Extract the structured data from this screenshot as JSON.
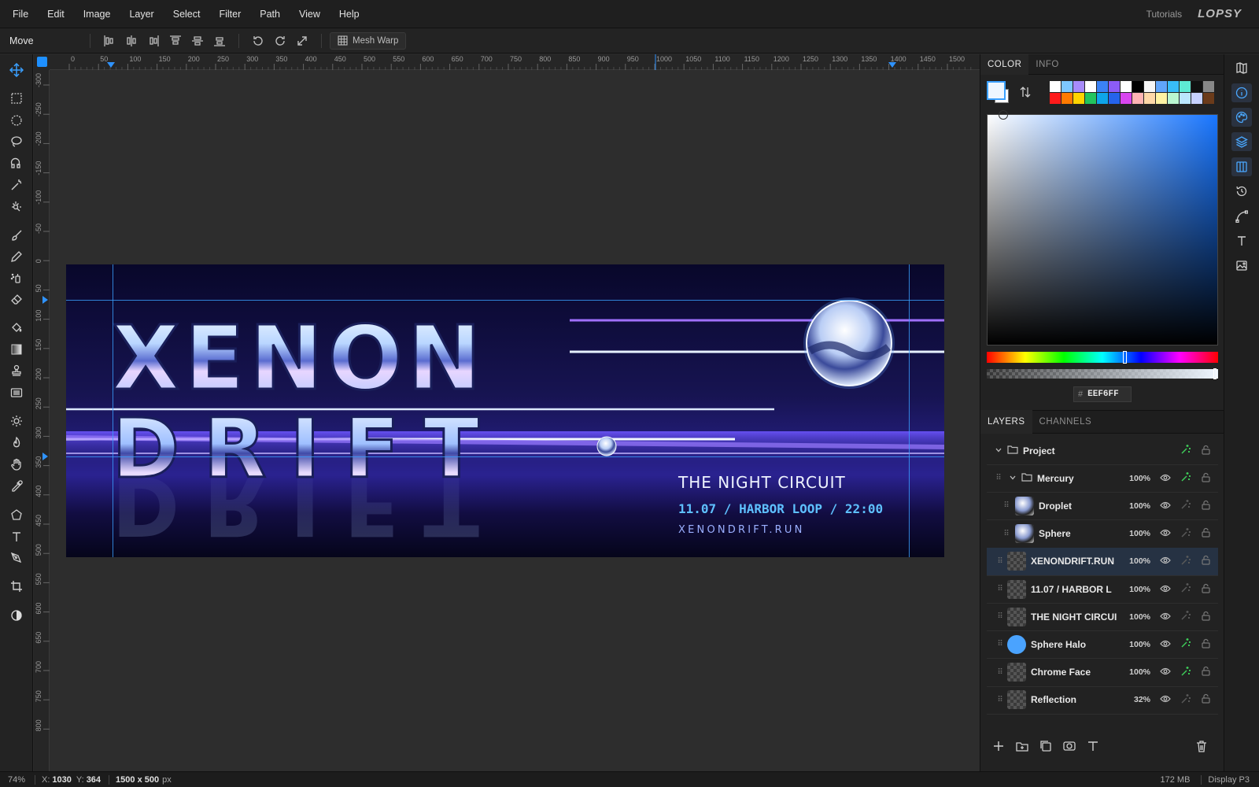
{
  "menu": {
    "items": [
      "File",
      "Edit",
      "Image",
      "Layer",
      "Select",
      "Filter",
      "Path",
      "View",
      "Help"
    ],
    "tutorials": "Tutorials",
    "logo": "LOPSY"
  },
  "options": {
    "tool_name": "Move",
    "mesh_warp": "Mesh Warp"
  },
  "ruler": {
    "top_ticks": [
      "0",
      "50",
      "100",
      "150",
      "200",
      "250",
      "300",
      "350",
      "400",
      "450",
      "500",
      "550",
      "600",
      "650",
      "700",
      "750",
      "800",
      "850",
      "900",
      "950",
      "1000",
      "1050",
      "1100",
      "1150",
      "1200",
      "1250",
      "1300",
      "1350",
      "1400",
      "1450",
      "1500"
    ],
    "left_ticks": [
      "-300",
      "-250",
      "-200",
      "-150",
      "-100",
      "-50",
      "0",
      "50",
      "100",
      "150",
      "200",
      "250",
      "300",
      "350",
      "400",
      "450",
      "500",
      "550",
      "600",
      "650",
      "700",
      "750",
      "800"
    ]
  },
  "artwork": {
    "title_line1": "XENON",
    "title_line2": "DRIFT",
    "subtitle": "THE NIGHT CIRCUIT",
    "date_line": "11.07 / HARBOR LOOP / 22:00",
    "url": "XENONDRIFT.RUN"
  },
  "color_panel": {
    "tabs": [
      "COLOR",
      "INFO"
    ],
    "hex_label": "#",
    "hex_value": "EEF6FF",
    "foreground": "#eef6ff",
    "swatches_row1": [
      "#ffffff",
      "#7ec8ff",
      "#a78bfa",
      "#ffffff",
      "#3b82f6",
      "#8b5cf6",
      "#ffffff",
      "#000000",
      "#f5f5f5",
      "#60a5fa",
      "#38bdf8",
      "#5eead4",
      "#111111",
      "#888888"
    ],
    "swatches_row2": [
      "#ff1a1a",
      "#ff7a00",
      "#ffd400",
      "#22c55e",
      "#0ea5e9",
      "#2563eb",
      "#d946ef",
      "#ffb4b4",
      "#ffd8a8",
      "#fff3a3",
      "#bbf7d0",
      "#bae6fd",
      "#c7d2fe",
      "#6b3b1a"
    ]
  },
  "layers_panel": {
    "tabs": [
      "LAYERS",
      "CHANNELS"
    ],
    "rows": [
      {
        "name": "Project",
        "opacity": "",
        "type": "group",
        "fx": true
      },
      {
        "name": "Mercury",
        "opacity": "100%",
        "type": "group",
        "fx": true
      },
      {
        "name": "Droplet",
        "opacity": "100%",
        "type": "sphere",
        "fx": false
      },
      {
        "name": "Sphere",
        "opacity": "100%",
        "type": "sphere",
        "fx": false
      },
      {
        "name": "XENONDRIFT.RUN",
        "opacity": "100%",
        "type": "text",
        "fx": false
      },
      {
        "name": "11.07 / HARBOR L",
        "opacity": "100%",
        "type": "text",
        "fx": false
      },
      {
        "name": "THE NIGHT CIRCUI",
        "opacity": "100%",
        "type": "text",
        "fx": false
      },
      {
        "name": "Sphere Halo",
        "opacity": "100%",
        "type": "halo",
        "fx": true
      },
      {
        "name": "Chrome Face",
        "opacity": "100%",
        "type": "chrome",
        "fx": true
      },
      {
        "name": "Reflection",
        "opacity": "32%",
        "type": "chrome",
        "fx": false
      }
    ]
  },
  "status": {
    "zoom": "74%",
    "coords_x_label": "X:",
    "coords_x": "1030",
    "coords_y_label": "Y:",
    "coords_y": "364",
    "doc_size": "1500 x 500",
    "doc_unit": "px",
    "memory": "172 MB",
    "color_profile": "Display P3"
  }
}
